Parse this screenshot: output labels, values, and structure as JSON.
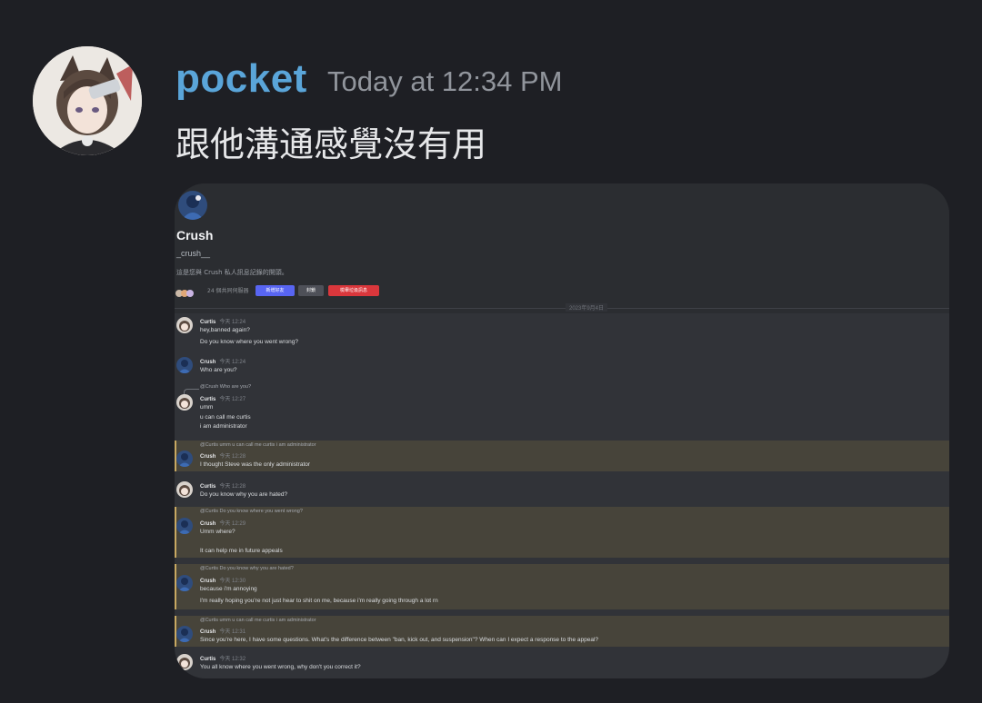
{
  "message": {
    "author": "pocket",
    "timestamp": "Today at 12:34 PM",
    "text": "跟他溝通感覺沒有用"
  },
  "embed": {
    "channel_name": "Crush",
    "handle": "_crush__",
    "description": "這是您與 Crush 私人訊息記錄的開頭。",
    "mutual_servers": "24 個共同伺服器",
    "btn_add_friend": "新增好友",
    "btn_block": "封鎖",
    "btn_report": "檢舉垃圾訊息",
    "divider_date": "2023年9月4日",
    "rows": [
      {
        "author": "Curtis",
        "time": "今天 12:24",
        "lines": [
          "hey,banned again?",
          "Do you know where you went wrong?"
        ]
      },
      {
        "author": "Crush",
        "time": "今天 12:24",
        "lines": [
          "Who are you?"
        ]
      },
      {
        "reply": "@Crush Who are you?",
        "author": "Curtis",
        "time": "今天 12:27",
        "lines": [
          "umm",
          "u can call me curtis",
          "i am administrator"
        ]
      },
      {
        "reply": "@Curtis umm u can call me curtis i am administrator",
        "author": "Crush",
        "time": "今天 12:28",
        "lines": [
          "I thought Steve was the only administrator"
        ]
      },
      {
        "author": "Curtis",
        "time": "今天 12:28",
        "lines": [
          "Do you know why you are hated?"
        ]
      },
      {
        "reply": "@Curtis Do you know where you went wrong?",
        "author": "Crush",
        "time": "今天 12:29",
        "lines": [
          "Umm where?",
          "",
          "It can help me in future appeals"
        ]
      },
      {
        "reply": "@Curtis Do you know why you are hated?",
        "author": "Crush",
        "time": "今天 12:30",
        "lines": [
          "because i'm annoying",
          "I'm really hoping you're not just hear to shit on me, because i'm really going through a lot rn"
        ]
      },
      {
        "reply": "@Curtis umm u can call me curtis i am administrator",
        "author": "Crush",
        "time": "今天 12:31",
        "lines": [
          "Since you're here, I have some questions.  What's the difference between \"ban, kick out, and suspension\"?  When can I expect a response to the appeal?"
        ]
      },
      {
        "author": "Curtis",
        "time": "今天 12:32",
        "lines": [
          "You all know where you went wrong, why don't you correct it?"
        ]
      }
    ]
  },
  "colors": {
    "background": "#1e1f24",
    "author_name": "#5aa5d9",
    "timestamp": "#91959c",
    "highlight_row": "#47443a",
    "button_blue": "#5865f2",
    "button_gray": "#4e5058",
    "button_red": "#da373c"
  }
}
